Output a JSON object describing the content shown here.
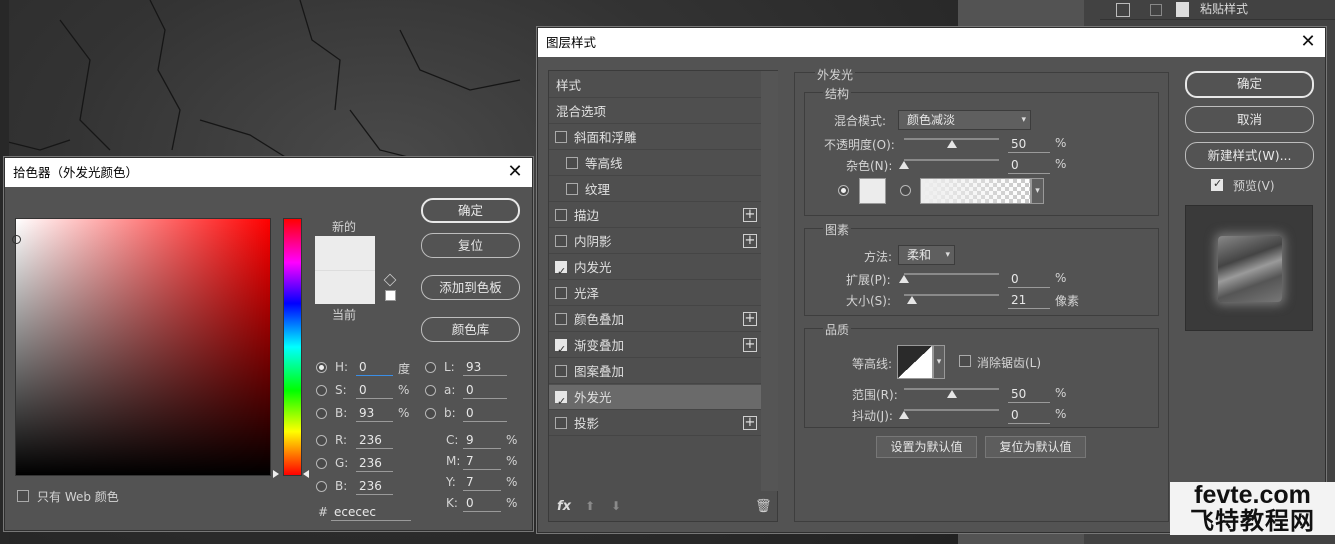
{
  "right_panel": {
    "paste_label": "粘贴样式"
  },
  "color_picker": {
    "title": "拾色器（外发光颜色）",
    "new_label": "新的",
    "current_label": "当前",
    "buttons": {
      "ok": "确定",
      "reset": "复位",
      "add_swatch": "添加到色板",
      "library": "颜色库"
    },
    "fields": {
      "H": {
        "label": "H:",
        "value": "0",
        "unit": "度"
      },
      "S": {
        "label": "S:",
        "value": "0",
        "unit": "%"
      },
      "B": {
        "label": "B:",
        "value": "93",
        "unit": "%"
      },
      "R": {
        "label": "R:",
        "value": "236"
      },
      "G": {
        "label": "G:",
        "value": "236"
      },
      "Bl": {
        "label": "B:",
        "value": "236"
      },
      "L": {
        "label": "L:",
        "value": "93"
      },
      "a": {
        "label": "a:",
        "value": "0"
      },
      "b": {
        "label": "b:",
        "value": "0"
      },
      "C": {
        "label": "C:",
        "value": "9",
        "unit": "%"
      },
      "M": {
        "label": "M:",
        "value": "7",
        "unit": "%"
      },
      "Y": {
        "label": "Y:",
        "value": "7",
        "unit": "%"
      },
      "K": {
        "label": "K:",
        "value": "0",
        "unit": "%"
      }
    },
    "hex_label": "#",
    "hex": "ececec",
    "web_only": "只有 Web 颜色",
    "color": "#ececec"
  },
  "layer_style": {
    "title": "图层样式",
    "list": {
      "header": "样式",
      "blend": "混合选项",
      "items": [
        {
          "label": "斜面和浮雕",
          "checked": false,
          "plus": false,
          "indent": false
        },
        {
          "label": "等高线",
          "checked": false,
          "plus": false,
          "indent": true
        },
        {
          "label": "纹理",
          "checked": false,
          "plus": false,
          "indent": true
        },
        {
          "label": "描边",
          "checked": false,
          "plus": true,
          "indent": false
        },
        {
          "label": "内阴影",
          "checked": false,
          "plus": true,
          "indent": false
        },
        {
          "label": "内发光",
          "checked": true,
          "plus": false,
          "indent": false
        },
        {
          "label": "光泽",
          "checked": false,
          "plus": false,
          "indent": false
        },
        {
          "label": "颜色叠加",
          "checked": false,
          "plus": true,
          "indent": false
        },
        {
          "label": "渐变叠加",
          "checked": true,
          "plus": true,
          "indent": false
        },
        {
          "label": "图案叠加",
          "checked": false,
          "plus": false,
          "indent": false
        },
        {
          "label": "外发光",
          "checked": true,
          "plus": false,
          "indent": false,
          "selected": true
        },
        {
          "label": "投影",
          "checked": false,
          "plus": true,
          "indent": false
        }
      ]
    },
    "section_title": "外发光",
    "structure": {
      "title": "结构",
      "blend_mode_label": "混合模式:",
      "blend_mode": "颜色减淡",
      "opacity_label": "不透明度(O):",
      "opacity": "50",
      "noise_label": "杂色(N):",
      "noise": "0",
      "unit": "%"
    },
    "elements": {
      "title": "图素",
      "method_label": "方法:",
      "method": "柔和",
      "spread_label": "扩展(P):",
      "spread": "0",
      "size_label": "大小(S):",
      "size": "21",
      "size_unit": "像素"
    },
    "quality": {
      "title": "品质",
      "contour_label": "等高线:",
      "antialias_label": "消除锯齿(L)",
      "range_label": "范围(R):",
      "range": "50",
      "jitter_label": "抖动(J):",
      "jitter": "0"
    },
    "defaults": {
      "set": "设置为默认值",
      "reset": "复位为默认值"
    },
    "buttons": {
      "ok": "确定",
      "cancel": "取消",
      "new_style": "新建样式(W)...",
      "preview": "预览(V)"
    }
  },
  "watermark": {
    "line1": "fevte.com",
    "line2": "飞特教程网"
  }
}
